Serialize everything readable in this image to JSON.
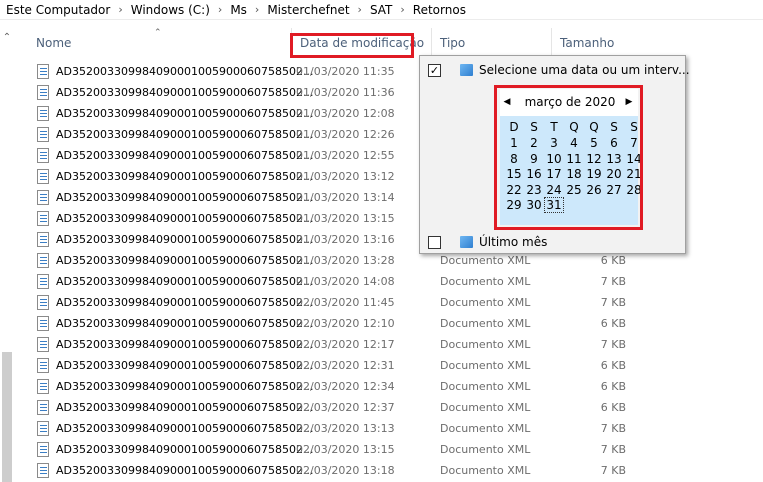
{
  "breadcrumb": [
    "Este Computador",
    "Windows (C:)",
    "Ms",
    "Misterchefnet",
    "SAT",
    "Retornos"
  ],
  "columns": {
    "name": "Nome",
    "date": "Data de modificação",
    "type": "Tipo",
    "size": "Tamanho"
  },
  "files": [
    {
      "name": "AD352003309984090001005900060758502...",
      "date": "01/03/2020 11:35",
      "type": "",
      "size": ""
    },
    {
      "name": "AD352003309984090001005900060758502...",
      "date": "01/03/2020 11:36",
      "type": "",
      "size": ""
    },
    {
      "name": "AD352003309984090001005900060758502...",
      "date": "01/03/2020 12:08",
      "type": "",
      "size": ""
    },
    {
      "name": "AD352003309984090001005900060758502...",
      "date": "01/03/2020 12:26",
      "type": "",
      "size": ""
    },
    {
      "name": "AD352003309984090001005900060758502...",
      "date": "01/03/2020 12:55",
      "type": "",
      "size": ""
    },
    {
      "name": "AD352003309984090001005900060758502...",
      "date": "01/03/2020 13:12",
      "type": "",
      "size": ""
    },
    {
      "name": "AD352003309984090001005900060758502...",
      "date": "01/03/2020 13:14",
      "type": "",
      "size": ""
    },
    {
      "name": "AD352003309984090001005900060758502...",
      "date": "01/03/2020 13:15",
      "type": "",
      "size": ""
    },
    {
      "name": "AD352003309984090001005900060758502...",
      "date": "01/03/2020 13:16",
      "type": "",
      "size": ""
    },
    {
      "name": "AD352003309984090001005900060758502...",
      "date": "01/03/2020 13:28",
      "type": "Documento XML",
      "size": "6 KB"
    },
    {
      "name": "AD352003309984090001005900060758502...",
      "date": "01/03/2020 14:08",
      "type": "Documento XML",
      "size": "7 KB"
    },
    {
      "name": "AD352003309984090001005900060758502...",
      "date": "02/03/2020 11:45",
      "type": "Documento XML",
      "size": "7 KB"
    },
    {
      "name": "AD352003309984090001005900060758502...",
      "date": "02/03/2020 12:10",
      "type": "Documento XML",
      "size": "6 KB"
    },
    {
      "name": "AD352003309984090001005900060758502...",
      "date": "02/03/2020 12:17",
      "type": "Documento XML",
      "size": "7 KB"
    },
    {
      "name": "AD352003309984090001005900060758502...",
      "date": "02/03/2020 12:31",
      "type": "Documento XML",
      "size": "6 KB"
    },
    {
      "name": "AD352003309984090001005900060758502...",
      "date": "02/03/2020 12:34",
      "type": "Documento XML",
      "size": "6 KB"
    },
    {
      "name": "AD352003309984090001005900060758502...",
      "date": "02/03/2020 12:37",
      "type": "Documento XML",
      "size": "6 KB"
    },
    {
      "name": "AD352003309984090001005900060758502...",
      "date": "02/03/2020 13:13",
      "type": "Documento XML",
      "size": "7 KB"
    },
    {
      "name": "AD352003309984090001005900060758502...",
      "date": "02/03/2020 13:15",
      "type": "Documento XML",
      "size": "7 KB"
    },
    {
      "name": "AD352003309984090001005900060758502...",
      "date": "02/03/2020 13:18",
      "type": "Documento XML",
      "size": "7 KB"
    }
  ],
  "filter": {
    "date_option": {
      "label": "Selecione uma data ou um interv...",
      "checked": true,
      "check_mark": "✓"
    },
    "last_month_option": {
      "label": "Último mês",
      "checked": false,
      "check_mark": ""
    },
    "calendar": {
      "month_label": "março de 2020",
      "prev_glyph": "◀",
      "next_glyph": "▶",
      "weekdays": [
        "D",
        "S",
        "T",
        "Q",
        "Q",
        "S",
        "S"
      ],
      "weeks": [
        [
          "1",
          "2",
          "3",
          "4",
          "5",
          "6",
          "7"
        ],
        [
          "8",
          "9",
          "10",
          "11",
          "12",
          "13",
          "14"
        ],
        [
          "15",
          "16",
          "17",
          "18",
          "19",
          "20",
          "21"
        ],
        [
          "22",
          "23",
          "24",
          "25",
          "26",
          "27",
          "28"
        ],
        [
          "29",
          "30",
          "31",
          "",
          "",
          "",
          ""
        ]
      ],
      "today": "31"
    }
  },
  "colors": {
    "highlight": "#e01b24",
    "calendar_bg": "#cde8fb",
    "header_text": "#4c607a"
  }
}
